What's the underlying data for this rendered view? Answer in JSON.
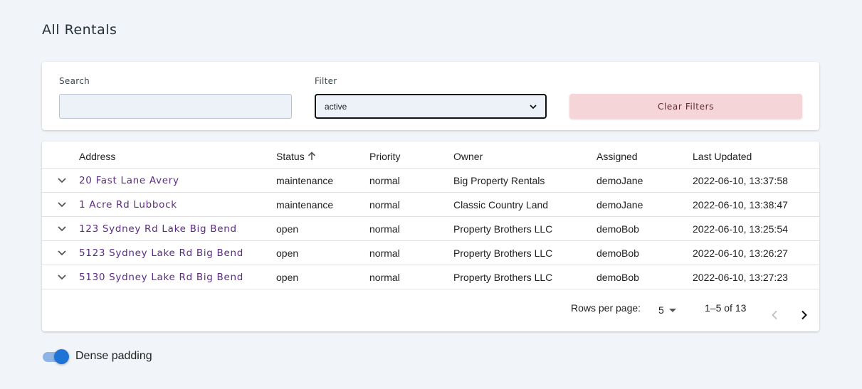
{
  "page": {
    "title": "All Rentals"
  },
  "filters": {
    "search_label": "Search",
    "search_value": "",
    "search_placeholder": "",
    "filter_label": "Filter",
    "filter_value": "active",
    "clear_label": "Clear Filters"
  },
  "table": {
    "headers": {
      "address": "Address",
      "status": "Status",
      "priority": "Priority",
      "owner": "Owner",
      "assigned": "Assigned",
      "updated": "Last Updated"
    },
    "sort": {
      "column": "status",
      "direction": "ascending",
      "icon": "arrow-up-icon"
    },
    "rows": [
      {
        "address": "20 Fast Lane Avery",
        "status": "maintenance",
        "priority": "normal",
        "owner": "Big Property Rentals",
        "assigned": "demoJane",
        "updated": "2022-06-10, 13:37:58"
      },
      {
        "address": "1 Acre Rd Lubbock",
        "status": "maintenance",
        "priority": "normal",
        "owner": "Classic Country Land",
        "assigned": "demoJane",
        "updated": "2022-06-10, 13:38:47"
      },
      {
        "address": "123 Sydney Rd Lake Big Bend",
        "status": "open",
        "priority": "normal",
        "owner": "Property Brothers LLC",
        "assigned": "demoBob",
        "updated": "2022-06-10, 13:25:54"
      },
      {
        "address": "5123 Sydney Lake Rd Big Bend",
        "status": "open",
        "priority": "normal",
        "owner": "Property Brothers LLC",
        "assigned": "demoBob",
        "updated": "2022-06-10, 13:26:27"
      },
      {
        "address": "5130 Sydney Lake Rd Big Bend",
        "status": "open",
        "priority": "normal",
        "owner": "Property Brothers LLC",
        "assigned": "demoBob",
        "updated": "2022-06-10, 13:27:23"
      }
    ]
  },
  "pagination": {
    "rows_per_page_label": "Rows per page:",
    "rows_per_page": "5",
    "range": "1–5 of 13"
  },
  "dense": {
    "label": "Dense padding",
    "enabled": true
  },
  "colors": {
    "link": "#5b2c83",
    "toggle": "#1e74d6",
    "clear_button": "#f6d5d8"
  }
}
